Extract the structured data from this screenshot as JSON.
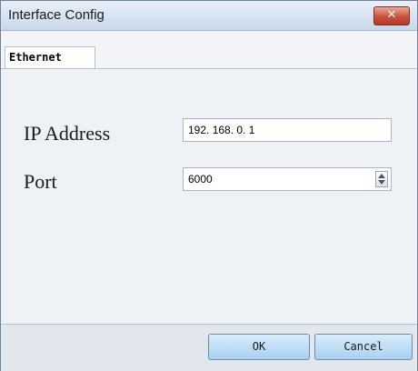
{
  "window": {
    "title": "Interface Config",
    "close_glyph": "✕"
  },
  "tabs": [
    {
      "label": "Ethernet",
      "selected": true
    }
  ],
  "form": {
    "ip_label": "IP Address",
    "ip_value": "192. 168. 0. 1",
    "port_label": "Port",
    "port_value": "6000"
  },
  "buttons": {
    "ok_label": "OK",
    "cancel_label": "Cancel"
  },
  "icons": {
    "close": "close-icon",
    "spinner_up": "chevron-up-icon",
    "spinner_down": "chevron-down-icon"
  },
  "colors": {
    "close_button": "#c9523e",
    "button_face": "#a9d0f0",
    "titlebar": "#c9d8ea"
  }
}
